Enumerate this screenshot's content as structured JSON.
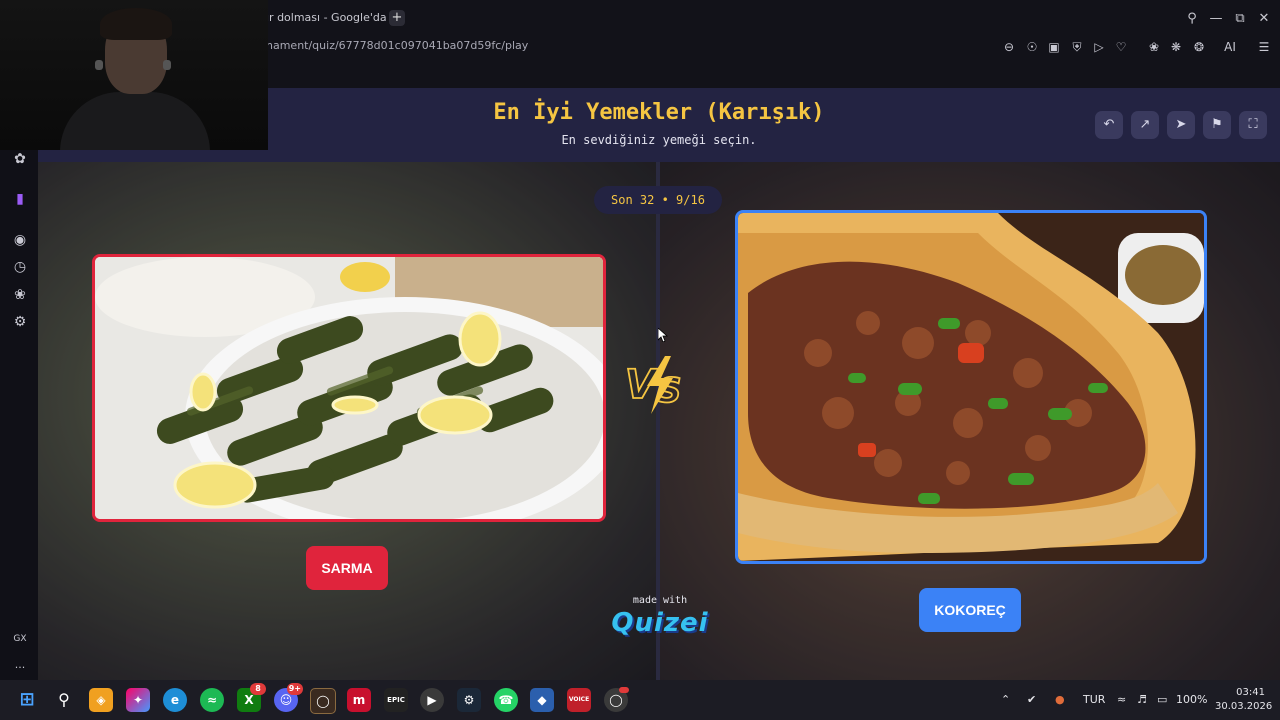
{
  "browser": {
    "tab_title": "ır dolması - Google'da A",
    "new_tab": "+",
    "url": "nament/quiz/67778d01c097041ba07d59fc/play",
    "ai_label": "AI",
    "gx_label": "GX",
    "more": "..."
  },
  "quiz": {
    "title": "En İyi Yemekler (Karışık)",
    "subtitle": "En sevdiğiniz yemeği seçin.",
    "round": "Son 32 • 9/16",
    "left_option": {
      "label": "SARMA",
      "image": "stuffed grape leaves with lemon slices on a white platter"
    },
    "right_option": {
      "label": "KOKOREÇ",
      "image": "kokoreç chopped with peppers in a bread half"
    },
    "vs_icon": "vs-lightning-icon",
    "made_with": "made with",
    "brand": "Quizei"
  },
  "header_actions": [
    "undo-icon",
    "share-icon",
    "send-icon",
    "flag-icon",
    "fullscreen-icon"
  ],
  "taskbar": {
    "language": "TUR",
    "battery": "100%",
    "time": "03:41",
    "date": "30.03.2026",
    "badges": {
      "xbox": "8",
      "discord": "9+"
    },
    "epic_label": "EPIC",
    "voicemeeter_label": "VOICE"
  },
  "colors": {
    "accent_red": "#e0243c",
    "accent_blue": "#3b82f6",
    "title_yellow": "#f5c542",
    "header_bg": "#232342"
  }
}
